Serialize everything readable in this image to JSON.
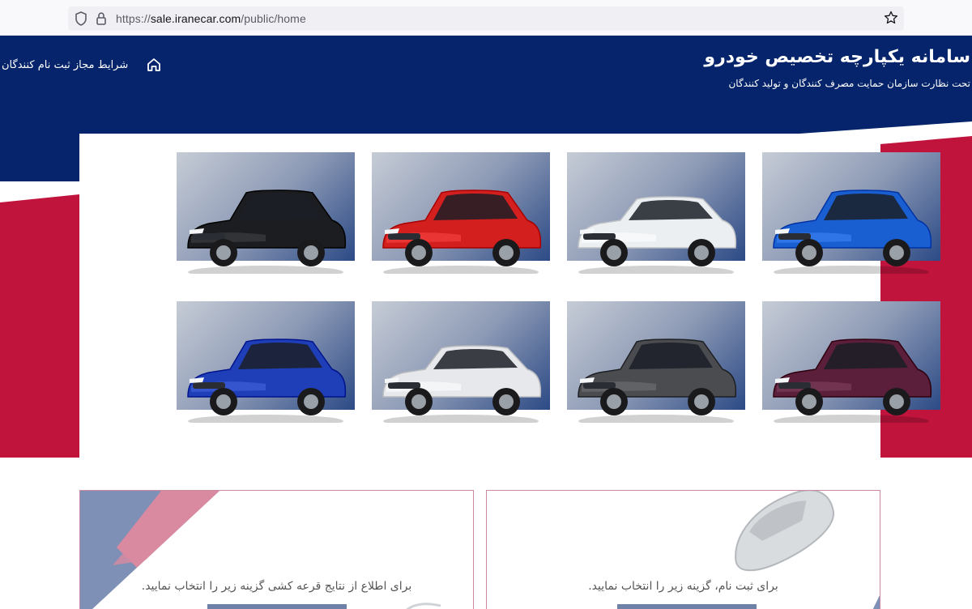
{
  "browser": {
    "url_prefix": "https://",
    "url_host": "sale.iranecar.com",
    "url_path": "/public/home"
  },
  "header": {
    "title": "سامانه یکپارچه تخصیص خودرو",
    "subtitle": "تحت نظارت سازمان حمایت مصرف کنندگان و تولید کنندگان",
    "nav_link": "شرایط مجاز ثبت نام کنندگان",
    "home_icon": "home-icon"
  },
  "colors": {
    "navy": "#05246b",
    "crimson": "#c0143c",
    "pink": "#d98aa0",
    "steel": "#7f90b6"
  },
  "cars": [
    {
      "color": "#1a5fd1",
      "type": "suv"
    },
    {
      "color": "#eceff2",
      "type": "sedan"
    },
    {
      "color": "#d41f1f",
      "type": "suv"
    },
    {
      "color": "#1c1d20",
      "type": "suv"
    },
    {
      "color": "#5b1e3b",
      "type": "suv"
    },
    {
      "color": "#4a4c50",
      "type": "suv"
    },
    {
      "color": "#e6e8eb",
      "type": "sedan"
    },
    {
      "color": "#1f3fb8",
      "type": "suv"
    }
  ],
  "options": {
    "registration_text": "برای ثبت نام، گزینه زیر را انتخاب نمایید.",
    "results_text": "برای اطلاع از نتایج قرعه کشی گزینه زیر را انتخاب نمایید."
  }
}
